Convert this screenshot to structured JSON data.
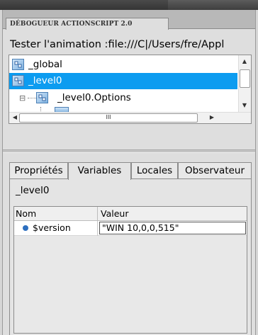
{
  "panel": {
    "tab_label": "DÉBOGUEUR ACTIONSCRIPT 2.0",
    "options_glyph": "▸≡"
  },
  "status": "Tester l'animation :file:///C|/Users/fre/Appl",
  "tree": {
    "items": [
      {
        "label": "_global",
        "selected": false,
        "icon": "movieclip-icon"
      },
      {
        "label": "_level0",
        "selected": true,
        "icon": "movieclip-icon"
      },
      {
        "label": "_level0.Options",
        "selected": false,
        "icon": "movieclip-icon",
        "expander": "⊟"
      }
    ],
    "hscroll_grip": "III"
  },
  "tabs": {
    "items": [
      {
        "label": "Propriétés"
      },
      {
        "label": "Variables"
      },
      {
        "label": "Locales"
      },
      {
        "label": "Observateur"
      }
    ],
    "active": "Variables"
  },
  "variables": {
    "target": "_level0",
    "columns": {
      "name": "Nom",
      "value": "Valeur"
    },
    "rows": [
      {
        "name": "$version",
        "value": "\"WIN 10,0,0,515\""
      }
    ]
  }
}
